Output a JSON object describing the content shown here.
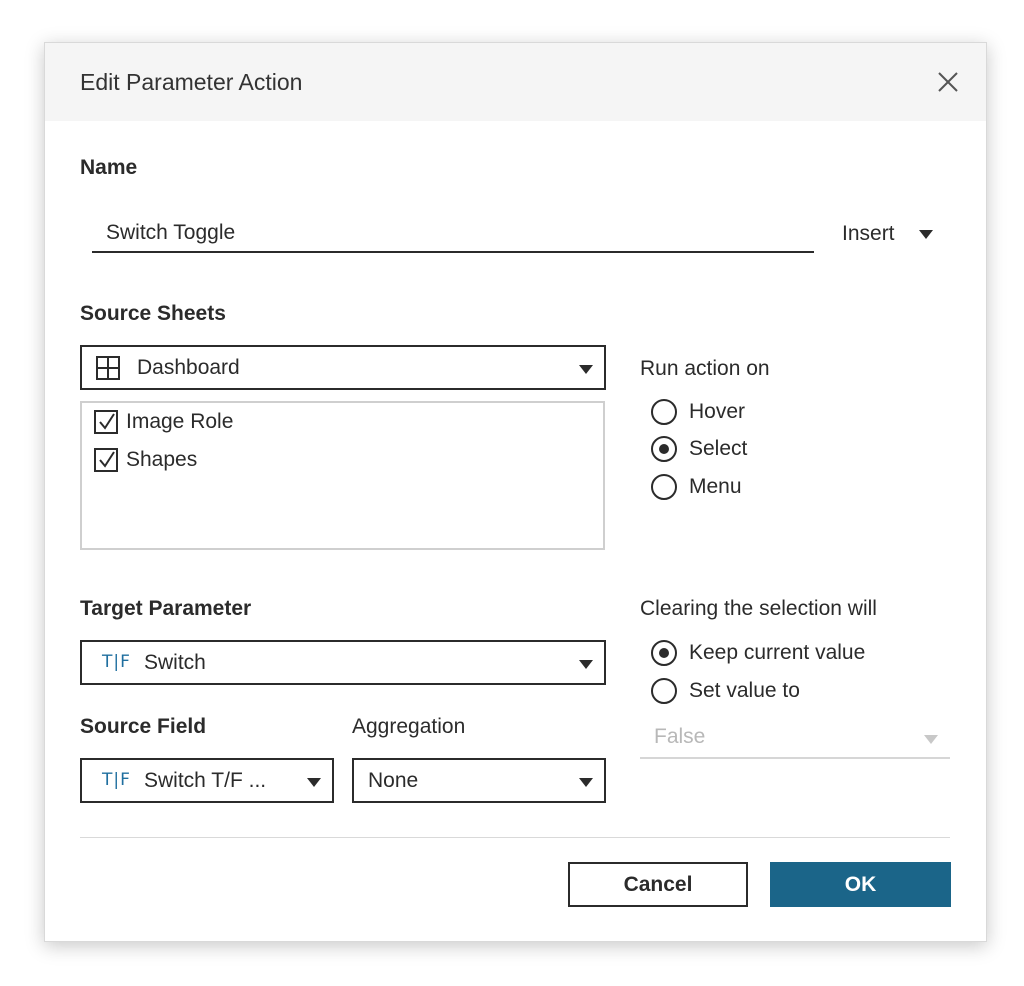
{
  "dialog": {
    "title": "Edit Parameter Action",
    "close_icon": "close-icon"
  },
  "name_section": {
    "label": "Name",
    "value": "Switch Toggle",
    "insert_label": "Insert"
  },
  "source_sheets": {
    "label": "Source Sheets",
    "selected": "Dashboard",
    "icon": "dashboard-grid-icon",
    "items": [
      {
        "label": "Image Role",
        "checked": true
      },
      {
        "label": "Shapes",
        "checked": true
      }
    ]
  },
  "run_action": {
    "label": "Run action on",
    "options": [
      {
        "label": "Hover",
        "selected": false
      },
      {
        "label": "Select",
        "selected": true
      },
      {
        "label": "Menu",
        "selected": false
      }
    ]
  },
  "target_parameter": {
    "label": "Target Parameter",
    "type_icon": "T|F",
    "selected": "Switch"
  },
  "clearing": {
    "label": "Clearing the selection will",
    "options": [
      {
        "label": "Keep current value",
        "selected": true
      },
      {
        "label": "Set value to",
        "selected": false
      }
    ],
    "value_placeholder": "False"
  },
  "source_field": {
    "label": "Source Field",
    "type_icon": "T|F",
    "selected": "Switch T/F ..."
  },
  "aggregation": {
    "label": "Aggregation",
    "selected": "None"
  },
  "buttons": {
    "cancel": "Cancel",
    "ok": "OK"
  },
  "colors": {
    "ok_button": "#1b6589",
    "type_icon": "#1f6f9f",
    "title_bar": "#f5f5f5"
  }
}
